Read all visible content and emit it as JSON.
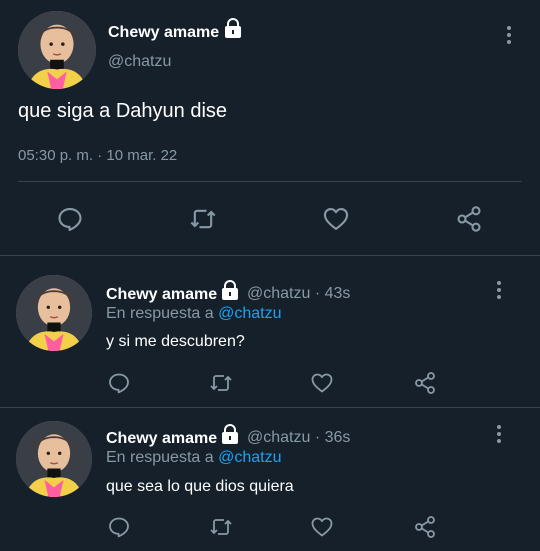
{
  "colors": {
    "background": "#15202b",
    "text": "#ffffff",
    "muted": "#8899a6",
    "link": "#1da1f2",
    "divider": "#38444d"
  },
  "main_tweet": {
    "author_name": "Chewy amame",
    "author_handle": "@chatzu",
    "text": "que siga a Dahyun dise",
    "timestamp": "05:30 p. m. · 10 mar. 22",
    "actions": [
      "reply-icon",
      "retweet-icon",
      "like-icon",
      "share-icon"
    ]
  },
  "replies": [
    {
      "author_name": "Chewy amame",
      "author_handle_time": "@chatzu · 43s",
      "reply_prefix": "En respuesta a",
      "reply_mention": "@chatzu",
      "text": "y si me descubren?"
    },
    {
      "author_name": "Chewy amame",
      "author_handle_time": "@chatzu · 36s",
      "reply_prefix": "En respuesta a",
      "reply_mention": "@chatzu",
      "text": "que sea lo que dios quiera"
    }
  ]
}
